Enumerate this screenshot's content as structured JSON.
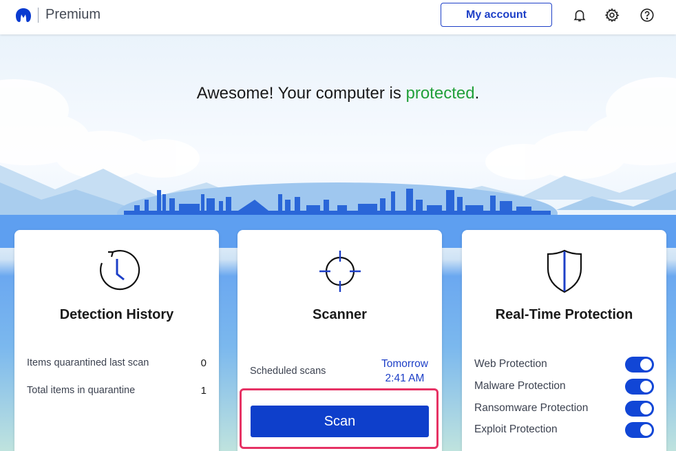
{
  "header": {
    "logo_icon": "malwarebytes-logo-icon",
    "product": "Premium",
    "my_account_label": "My account",
    "icons": [
      "bell-icon",
      "gear-icon",
      "help-icon"
    ],
    "accent_color": "#1d3fc7"
  },
  "hero": {
    "headline_prefix": "Awesome! Your computer is ",
    "headline_status": "protected",
    "headline_suffix": ".",
    "status_color": "#22a03a"
  },
  "cards": {
    "detection_history": {
      "icon": "history-clock-icon",
      "title": "Detection History",
      "rows": [
        {
          "label": "Items quarantined last scan",
          "value": "0"
        },
        {
          "label": "Total items in quarantine",
          "value": "1"
        }
      ]
    },
    "scanner": {
      "icon": "crosshair-icon",
      "title": "Scanner",
      "scheduled_label": "Scheduled scans",
      "scheduled_day": "Tomorrow",
      "scheduled_time": "2:41 AM",
      "scan_label": "Scan",
      "highlight_color": "#e63264"
    },
    "real_time": {
      "icon": "shield-icon",
      "title": "Real-Time Protection",
      "items": [
        {
          "label": "Web Protection",
          "enabled": true
        },
        {
          "label": "Malware Protection",
          "enabled": true
        },
        {
          "label": "Ransomware Protection",
          "enabled": true
        },
        {
          "label": "Exploit Protection",
          "enabled": true
        }
      ]
    }
  }
}
